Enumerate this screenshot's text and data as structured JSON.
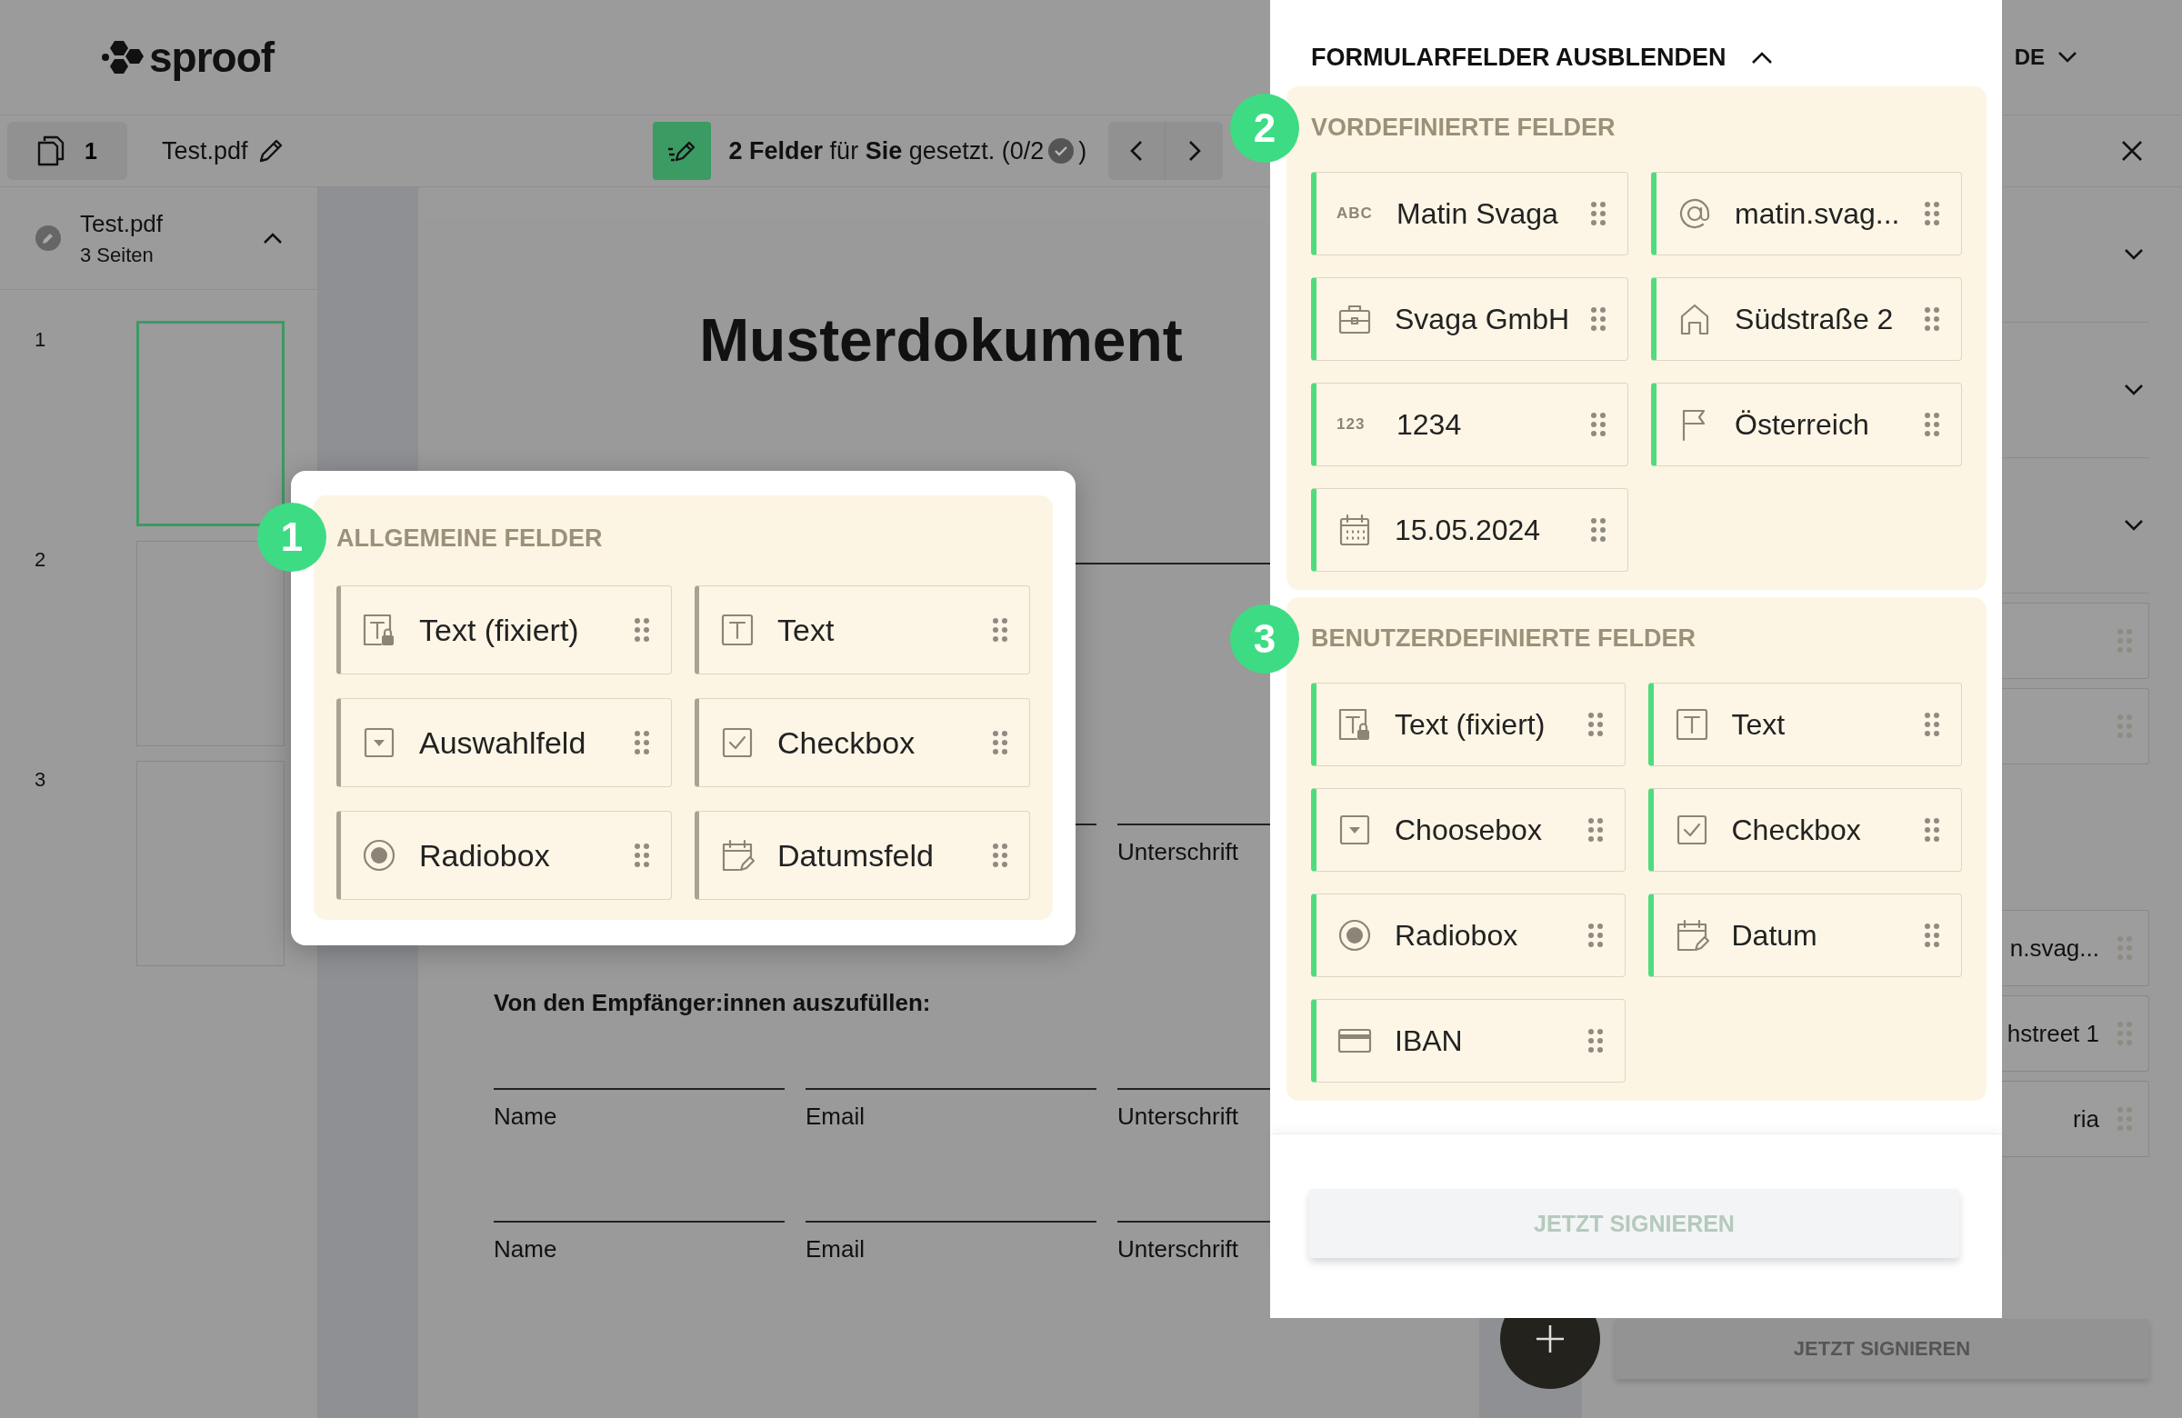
{
  "header": {
    "logo": "sproof",
    "language": "DE"
  },
  "toolbar": {
    "page_count": "1",
    "file_name": "Test.pdf",
    "status": "**2 Felder** für **Sie** gesetzt. (0/2",
    "status_end": ")"
  },
  "sidebar": {
    "document": {
      "name": "Test.pdf",
      "pages": "3 Seiten",
      "expanded": true
    },
    "thumbnails": [
      {
        "number": "1",
        "selected": true
      },
      {
        "number": "2",
        "selected": false
      },
      {
        "number": "3",
        "selected": false
      }
    ]
  },
  "document": {
    "title": "Musterdokument",
    "partial_label": "Unterschrift",
    "recipients_heading": "Von den Empfänger:innen auszufüllen:",
    "recipient_rows": [
      [
        "Name",
        "Email",
        "Unterschrift"
      ],
      [
        "Name",
        "Email",
        "Unterschrift"
      ]
    ]
  },
  "right_sidebar": {
    "partial_rows": [
      "n.svag...",
      "hstreet 1",
      "ria"
    ],
    "sign_button": "JETZT SIGNIEREN"
  },
  "general_fields": {
    "badge": "1",
    "title": "ALLGEMEINE FELDER",
    "fields": [
      {
        "kind": "text-fixed",
        "label": "Text (fixiert)"
      },
      {
        "kind": "text",
        "label": "Text"
      },
      {
        "kind": "select",
        "label": "Auswahlfeld"
      },
      {
        "kind": "checkbox",
        "label": "Checkbox"
      },
      {
        "kind": "radio",
        "label": "Radiobox"
      },
      {
        "kind": "date",
        "label": "Datumsfeld"
      }
    ]
  },
  "form_panel": {
    "toggle": "FORMULARFELDER AUSBLENDEN",
    "expanded": true,
    "sections": [
      {
        "badge": "2",
        "title": "VORDEFINIERTE FELDER",
        "fields": [
          {
            "kind": "name",
            "icon_text": "ABC",
            "label": "Matin Svaga"
          },
          {
            "kind": "email",
            "label": "matin.svag..."
          },
          {
            "kind": "company",
            "label": "Svaga GmbH"
          },
          {
            "kind": "address",
            "label": "Südstraße 2"
          },
          {
            "kind": "number",
            "icon_text": "123",
            "label": "1234"
          },
          {
            "kind": "country",
            "label": "Österreich"
          },
          {
            "kind": "calendar",
            "label": "15.05.2024"
          }
        ]
      },
      {
        "badge": "3",
        "title": "BENUTZERDEFINIERTE FELDER",
        "fields": [
          {
            "kind": "text-fixed",
            "label": "Text (fixiert)"
          },
          {
            "kind": "text",
            "label": "Text"
          },
          {
            "kind": "select",
            "label": "Choosebox"
          },
          {
            "kind": "checkbox",
            "label": "Checkbox"
          },
          {
            "kind": "radio",
            "label": "Radiobox"
          },
          {
            "kind": "date",
            "label": "Datum"
          },
          {
            "kind": "iban",
            "label": "IBAN"
          }
        ]
      }
    ],
    "sign_button": "JETZT SIGNIEREN"
  }
}
